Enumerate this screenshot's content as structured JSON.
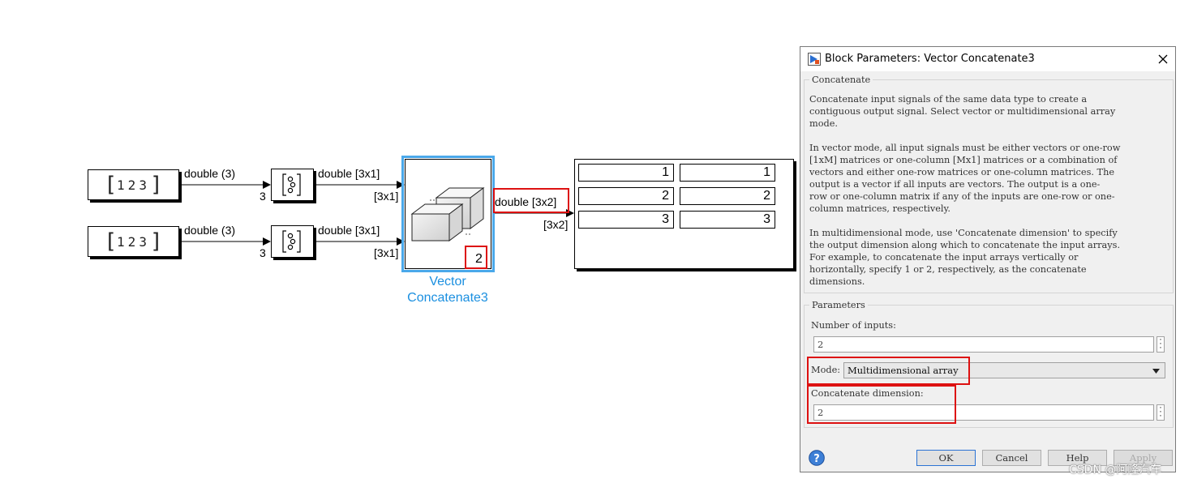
{
  "model": {
    "const1": {
      "values": [
        "1",
        "2",
        "3"
      ]
    },
    "const2": {
      "values": [
        "1",
        "2",
        "3"
      ]
    },
    "sig_const1": "double (3)",
    "sig_const2": "double (3)",
    "port_dim1": "3",
    "port_dim2": "3",
    "sig_reshape1": "double [3x1]",
    "sig_reshape2": "double [3x1]",
    "dim_in1": "[3x1]",
    "dim_in2": "[3x1]",
    "concat_dim_label": "2",
    "concat_caption_line1": "Vector",
    "concat_caption_line2": "Concatenate3",
    "sig_out": "double [3x2]",
    "dim_out": "[3x2]",
    "display": {
      "col1": [
        "1",
        "2",
        "3"
      ],
      "col2": [
        "1",
        "2",
        "3"
      ]
    }
  },
  "dialog": {
    "title": "Block Parameters: Vector Concatenate3",
    "group1_label": "Concatenate",
    "desc_p1": [
      "Concatenate input signals of the same data type to create a",
      "contiguous output signal. Select vector or multidimensional array",
      "mode."
    ],
    "desc_p2": [
      "In vector mode, all input signals must be either vectors or one-row",
      "[1xM] matrices or one-column [Mx1] matrices or a combination of",
      "vectors and either one-row matrices or one-column matrices. The",
      "output is a vector if all inputs are vectors. The output is a one-",
      "row or one-column matrix if any of the inputs are one-row or one-",
      "column matrices, respectively."
    ],
    "desc_p3": [
      "In multidimensional mode, use 'Concatenate dimension' to specify",
      "the output dimension along which to concatenate the input arrays.",
      "For example, to concatenate the input arrays vertically or",
      "horizontally, specify 1 or 2, respectively, as the concatenate",
      "dimensions."
    ],
    "group2_label": "Parameters",
    "num_inputs_label": "Number of inputs:",
    "num_inputs_value": "2",
    "mode_label": "Mode:",
    "mode_value": "Multidimensional array",
    "concat_dim_label": "Concatenate dimension:",
    "concat_dim_value": "2",
    "btn_ok": "OK",
    "btn_cancel": "Cancel",
    "btn_help": "Help",
    "btn_apply": "Apply"
  },
  "watermark": "CSDN @阿隆汽车",
  "colors": {
    "highlight_red": "#d11111",
    "selection_blue": "#1a8fe0"
  }
}
